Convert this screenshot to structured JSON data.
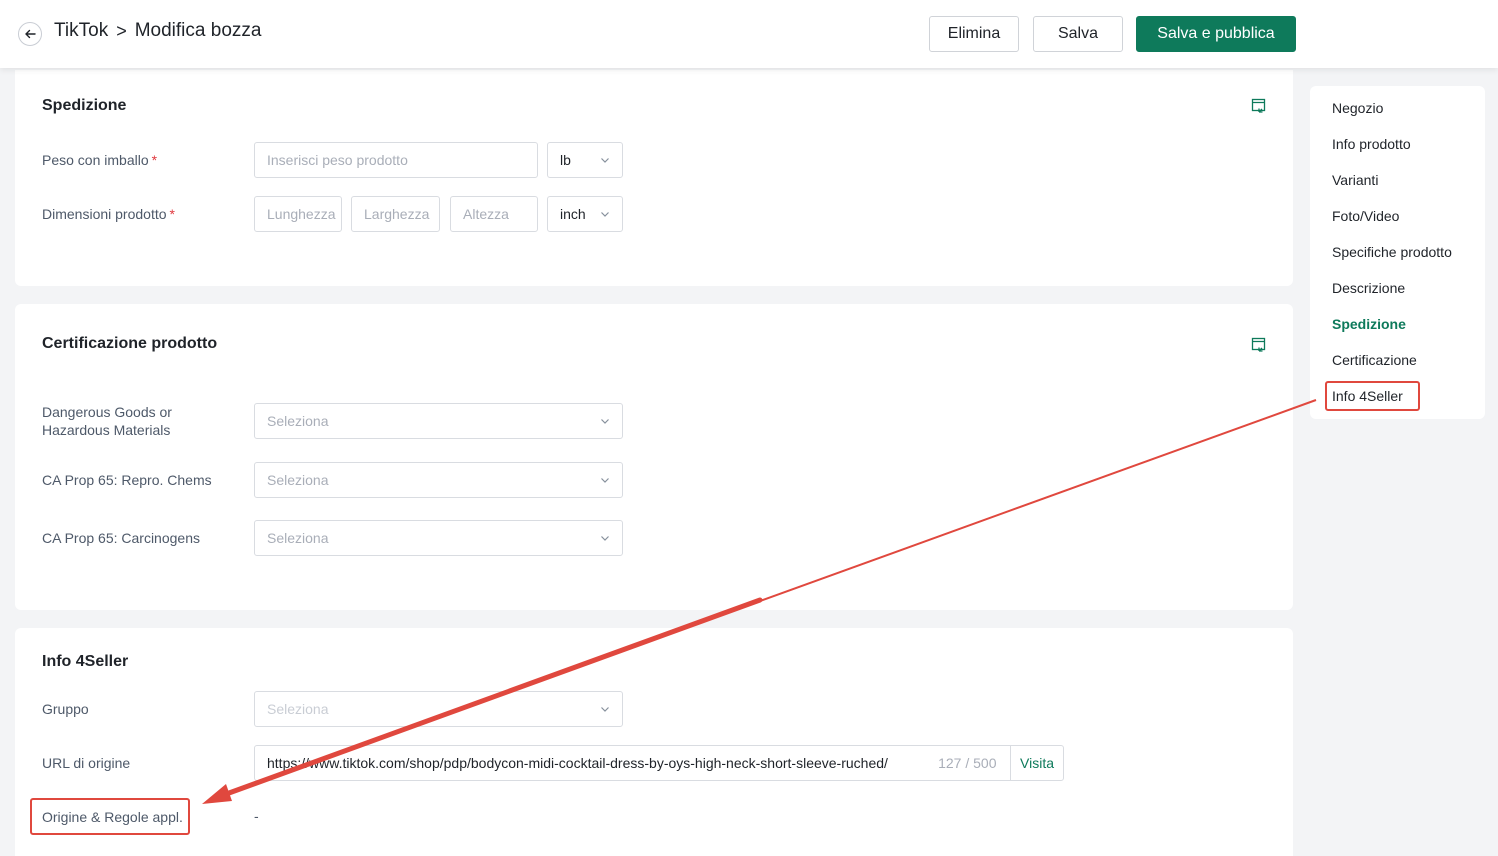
{
  "header": {
    "breadcrumb_root": "TikTok",
    "breadcrumb_separator": ">",
    "page_title": "Modifica bozza",
    "delete_label": "Elimina",
    "save_label": "Salva",
    "publish_label": "Salva e pubblica"
  },
  "shipping": {
    "title": "Spedizione",
    "weight_label": "Peso con imballo",
    "weight_placeholder": "Inserisci peso prodotto",
    "weight_unit": "lb",
    "dimensions_label": "Dimensioni prodotto",
    "length_placeholder": "Lunghezza",
    "width_placeholder": "Larghezza",
    "height_placeholder": "Altezza",
    "dimension_unit": "inch",
    "required_mark": "*"
  },
  "certification": {
    "title": "Certificazione prodotto",
    "dangerous_label": "Dangerous Goods or Hazardous Materials",
    "prop65_repro_label": "CA Prop 65: Repro. Chems",
    "prop65_carc_label": "CA Prop 65: Carcinogens",
    "select_placeholder": "Seleziona"
  },
  "info4seller": {
    "title": "Info 4Seller",
    "group_label": "Gruppo",
    "group_placeholder": "Seleziona",
    "source_url_label": "URL di origine",
    "source_url_value": "https://www.tiktok.com/shop/pdp/bodycon-midi-cocktail-dress-by-oys-high-neck-short-sleeve-ruched/",
    "source_url_count": "127 / 500",
    "visit_label": "Visita",
    "origin_rules_label": "Origine & Regole appl.",
    "origin_rules_value": "-"
  },
  "sidenav": {
    "items": [
      {
        "label": "Negozio"
      },
      {
        "label": "Info prodotto"
      },
      {
        "label": "Varianti"
      },
      {
        "label": "Foto/Video"
      },
      {
        "label": "Specifiche prodotto"
      },
      {
        "label": "Descrizione"
      },
      {
        "label": "Spedizione"
      },
      {
        "label": "Certificazione"
      },
      {
        "label": "Info 4Seller"
      }
    ],
    "active_item": "Spedizione"
  },
  "colors": {
    "accent": "#0e7a5b",
    "annotation": "#e0483e",
    "required": "#e0383e"
  }
}
